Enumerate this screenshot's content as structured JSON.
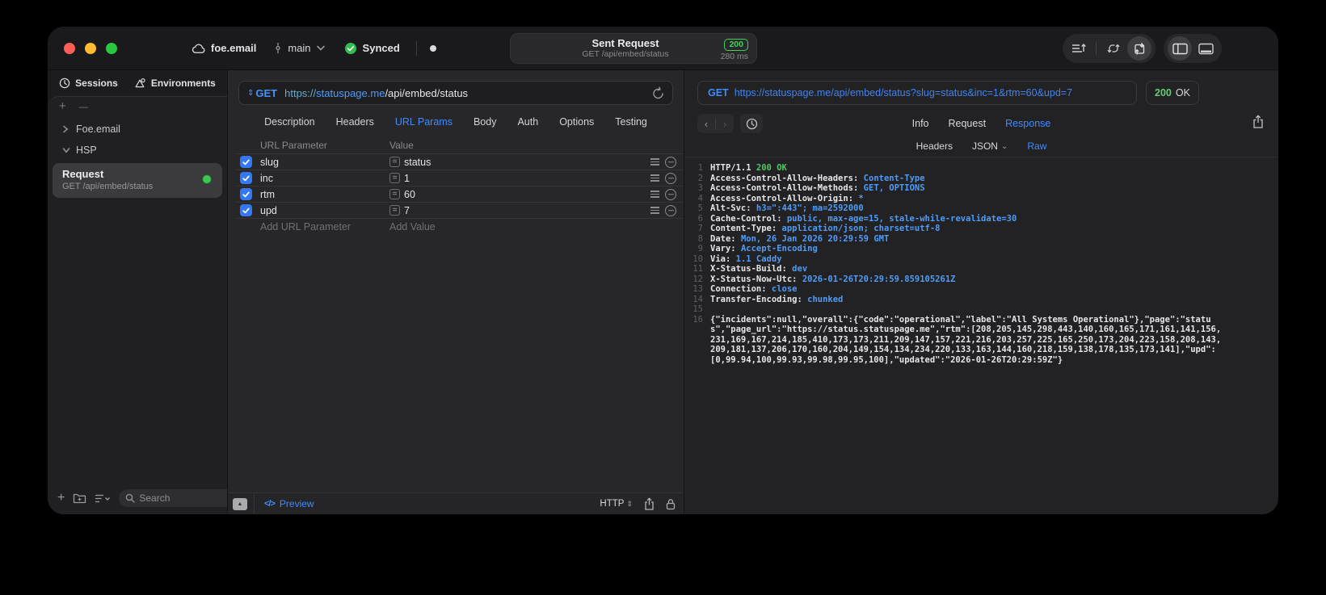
{
  "glyphs": {
    "plus": "+",
    "minus": "—",
    "equals": "=",
    "chevron_right": "›",
    "chevron_down": "⌄",
    "back": "‹",
    "forward": "›",
    "triangle_up": "▲",
    "updown": "⇕",
    "code": "</>"
  },
  "titlebar": {
    "project": "foe.email",
    "branch": "main",
    "sync_status": "Synced",
    "request_title": "Sent Request",
    "request_subtitle": "GET /api/embed/status",
    "status_code": "200",
    "duration": "280 ms"
  },
  "sidebar": {
    "tabs": [
      "Sessions",
      "Environments"
    ],
    "tree": [
      {
        "label": "Foe.email"
      },
      {
        "label": "HSP"
      }
    ],
    "request_item": {
      "title": "Request",
      "subtitle": "GET /api/embed/status"
    },
    "search_placeholder": "Search"
  },
  "request_editor": {
    "method": "GET",
    "url_scheme": "https://",
    "url_host": "statuspage.me",
    "url_path": "/api/embed/status",
    "tabs": [
      "Description",
      "Headers",
      "URL Params",
      "Body",
      "Auth",
      "Options",
      "Testing"
    ],
    "active_tab": "URL Params",
    "params": {
      "col_name": "URL Parameter",
      "col_value": "Value",
      "rows": [
        {
          "name": "slug",
          "value": "status"
        },
        {
          "name": "inc",
          "value": "1"
        },
        {
          "name": "rtm",
          "value": "60"
        },
        {
          "name": "upd",
          "value": "7"
        }
      ],
      "add_name": "Add URL Parameter",
      "add_value": "Add Value"
    },
    "footer": {
      "preview": "Preview",
      "protocol": "HTTP"
    }
  },
  "response_viewer": {
    "method": "GET",
    "url": "https://statuspage.me/api/embed/status?slug=status&inc=1&rtm=60&upd=7",
    "status_code": "200",
    "status_text": "OK",
    "tabs": [
      "Info",
      "Request",
      "Response"
    ],
    "active_tab": "Response",
    "view_tabs": [
      "Headers",
      "JSON",
      "Raw"
    ],
    "active_view": "Raw",
    "raw": {
      "sep": ": ",
      "status_line": {
        "num": "1",
        "protocol": "HTTP/1.1 ",
        "status": "200 OK"
      },
      "headers": [
        {
          "num": "2",
          "name": "Access-Control-Allow-Headers",
          "value": "Content-Type"
        },
        {
          "num": "3",
          "name": "Access-Control-Allow-Methods",
          "value": "GET, OPTIONS"
        },
        {
          "num": "4",
          "name": "Access-Control-Allow-Origin",
          "value": "*"
        },
        {
          "num": "5",
          "name": "Alt-Svc",
          "value": "h3=\":443\"; ma=2592000"
        },
        {
          "num": "6",
          "name": "Cache-Control",
          "value": "public, max-age=15, stale-while-revalidate=30"
        },
        {
          "num": "7",
          "name": "Content-Type",
          "value": "application/json; charset=utf-8"
        },
        {
          "num": "8",
          "name": "Date",
          "value": "Mon, 26 Jan 2026 20:29:59 GMT"
        },
        {
          "num": "9",
          "name": "Vary",
          "value": "Accept-Encoding"
        },
        {
          "num": "10",
          "name": "Via",
          "value": "1.1 Caddy"
        },
        {
          "num": "11",
          "name": "X-Status-Build",
          "value": "dev"
        },
        {
          "num": "12",
          "name": "X-Status-Now-Utc",
          "value": "2026-01-26T20:29:59.859105261Z"
        },
        {
          "num": "13",
          "name": "Connection",
          "value": "close"
        },
        {
          "num": "14",
          "name": "Transfer-Encoding",
          "value": "chunked"
        }
      ],
      "blank_num": "15",
      "body": {
        "num": "16",
        "text": "{\"incidents\":null,\"overall\":{\"code\":\"operational\",\"label\":\"All Systems Operational\"},\"page\":\"status\",\"page_url\":\"https://status.statuspage.me\",\"rtm\":[208,205,145,298,443,140,160,165,171,161,141,156,231,169,167,214,185,410,173,173,211,209,147,157,221,216,203,257,225,165,250,173,204,223,158,208,143,209,181,137,206,170,160,204,149,154,134,234,220,133,163,144,160,218,159,138,178,135,173,141],\"upd\":[0,99.94,100,99.93,99.98,99.95,100],\"updated\":\"2026-01-26T20:29:59Z\"}"
      }
    }
  }
}
